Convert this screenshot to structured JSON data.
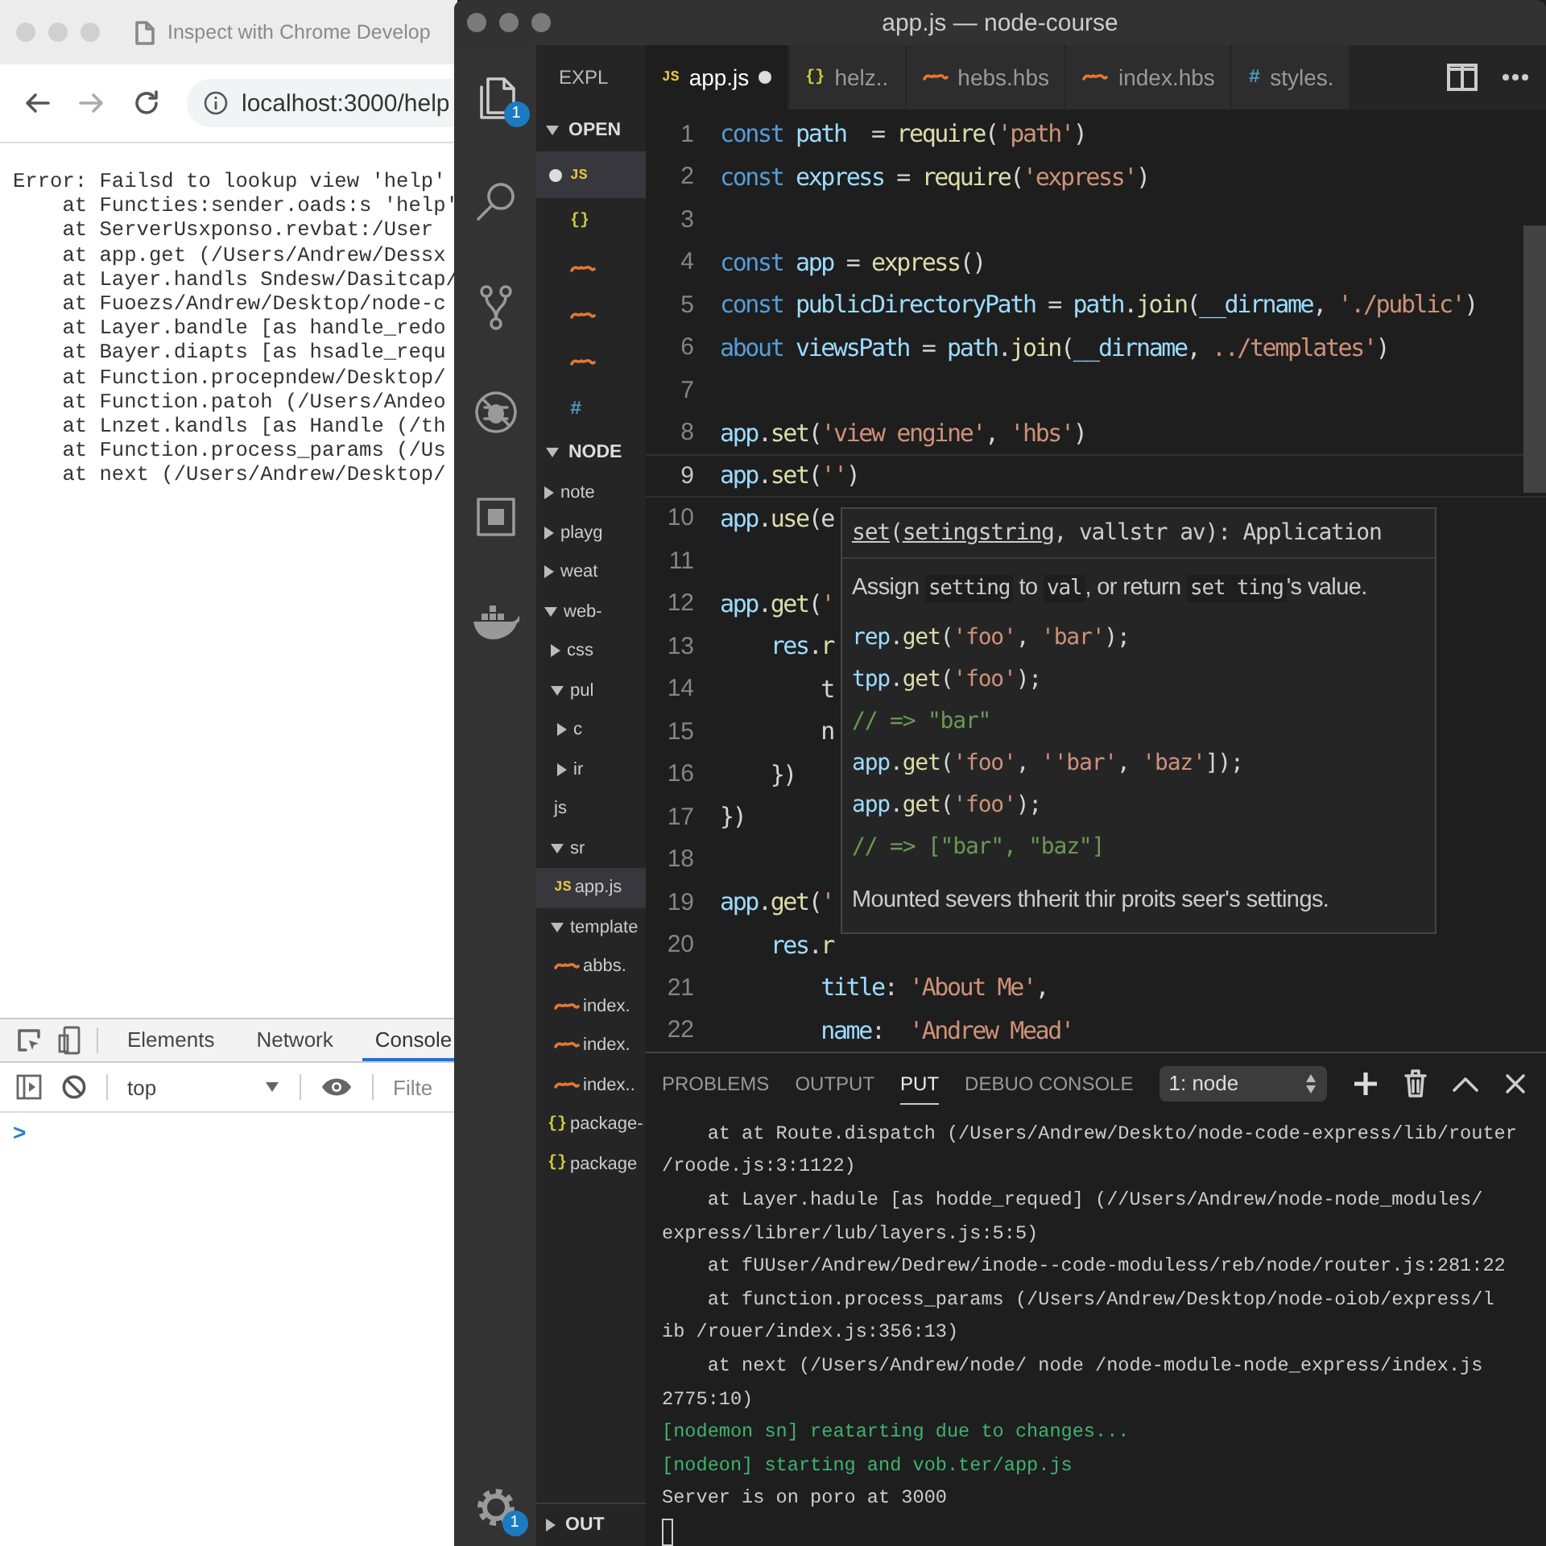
{
  "browser": {
    "tab_title": "Inspect with Chrome Develop",
    "url": "localhost:3000/help",
    "page_lines": [
      "Error: Failsd to lookup view 'help'",
      "    at Functies:sender.oads:s 'help'",
      "    at ServerUsxponso.revbat:/User",
      "    at app.get (/Users/Andrew/Dessx",
      "    at Layer.handls Sndesw/Dasitcap/",
      "    at Fuoezs/Andrew/Desktop/node-c",
      "    at Layer.bandle [as handle_redo",
      "    at Bayer.diapts [as hsadle_requ",
      "    at Function.procepndew/Desktop/",
      "    at Function.patoh (/Users/Andeo",
      "    at Lnzet.kandls [as Handle (/th",
      "    at Function.process_params (/Us",
      "    at next (/Users/Andrew/Desktop/"
    ],
    "devtools": {
      "tabs": [
        {
          "label": "Elements",
          "selected": false
        },
        {
          "label": "Network",
          "selected": false
        },
        {
          "label": "Console",
          "selected": true
        }
      ],
      "context": "top",
      "filter_placeholder": "Filte",
      "prompt": ">"
    }
  },
  "editor_window": {
    "title": "app.js — node-course",
    "activity_bar": {
      "items": [
        {
          "kind": "files",
          "badge": "1"
        },
        {
          "kind": "search"
        },
        {
          "kind": "branch"
        },
        {
          "kind": "debug"
        },
        {
          "kind": "extensions"
        },
        {
          "kind": "whale"
        }
      ],
      "manage": {
        "badge": "1"
      }
    },
    "sidebar": {
      "title": "EXPL",
      "open_editors": {
        "header": "OPEN",
        "expanded": true,
        "items": [
          {
            "kind": "js",
            "icon": "JS",
            "dirty": true,
            "selected": true
          },
          {
            "kind": "json",
            "icon": "{}",
            "dirty": false,
            "selected": false
          },
          {
            "kind": "hbs",
            "dirty": false,
            "selected": false
          },
          {
            "kind": "hbs",
            "dirty": false,
            "selected": false
          },
          {
            "kind": "hbs",
            "dirty": false,
            "selected": false
          },
          {
            "kind": "css",
            "icon": "#",
            "dirty": false,
            "selected": false
          }
        ]
      },
      "folder": {
        "header": "NODE",
        "expanded": true,
        "items": [
          {
            "kind": "folder",
            "label": "note",
            "expanded": false,
            "selected": false
          },
          {
            "kind": "folder",
            "label": "playg",
            "expanded": false,
            "selected": false
          },
          {
            "kind": "folder",
            "label": "weat",
            "expanded": false,
            "selected": false
          },
          {
            "kind": "folder",
            "label": "web-",
            "expanded": true,
            "selected": false,
            "children": [
              {
                "kind": "folder",
                "label": "css",
                "expanded": false,
                "selected": false
              },
              {
                "kind": "folder",
                "label": "pul",
                "expanded": true,
                "selected": false,
                "children": [
                  {
                    "kind": "folder",
                    "label": "c",
                    "expanded": false,
                    "selected": false
                  },
                  {
                    "kind": "folder",
                    "label": "ir",
                    "expanded": false,
                    "selected": false
                  },
                  {
                    "kind": "plain",
                    "label": "js",
                    "selected": false
                  }
                ]
              },
              {
                "kind": "folder",
                "label": "sr",
                "expanded": true,
                "selected": false,
                "children": [
                  {
                    "kind": "js",
                    "icon": "JS",
                    "label": "app.js",
                    "selected": true
                  }
                ]
              },
              {
                "kind": "folder",
                "label": "template",
                "expanded": true,
                "selected": false,
                "children": [
                  {
                    "kind": "hbs",
                    "label": "abbs.",
                    "selected": false
                  },
                  {
                    "kind": "hbs",
                    "label": "index.",
                    "selected": false
                  },
                  {
                    "kind": "hbs",
                    "label": "index.",
                    "selected": false
                  },
                  {
                    "kind": "hbs",
                    "label": "index..",
                    "selected": false
                  }
                ]
              },
              {
                "kind": "json",
                "icon": "{}",
                "label": "package-",
                "selected": false
              },
              {
                "kind": "json",
                "icon": "{}",
                "label": "package",
                "selected": false
              }
            ]
          }
        ]
      },
      "outline": {
        "header": "OUT",
        "expanded": false
      }
    },
    "tabs": [
      {
        "kind": "js",
        "icon": "JS",
        "label": "app.js",
        "selected": true,
        "dirty": true
      },
      {
        "kind": "json",
        "icon": "{}",
        "label": "helz..",
        "selected": false,
        "dirty": false
      },
      {
        "kind": "hbs",
        "label": "hebs.hbs",
        "selected": false,
        "dirty": false
      },
      {
        "kind": "hbs",
        "label": "index.hbs",
        "selected": false,
        "dirty": false
      },
      {
        "kind": "css",
        "icon": "#",
        "label": "styles.",
        "selected": false,
        "dirty": false
      }
    ],
    "code_lines": [
      {
        "number": "1",
        "current": false,
        "tokens": [
          {
            "kind": "keyword",
            "text": "const "
          },
          {
            "kind": "name",
            "text": "path"
          },
          {
            "kind": "plain",
            "text": "  = "
          },
          {
            "kind": "call",
            "text": "require"
          },
          {
            "kind": "plain",
            "text": "("
          },
          {
            "kind": "string",
            "text": "'path'"
          },
          {
            "kind": "plain",
            "text": ")"
          }
        ]
      },
      {
        "number": "2",
        "current": false,
        "tokens": [
          {
            "kind": "keyword",
            "text": "const "
          },
          {
            "kind": "name",
            "text": "express"
          },
          {
            "kind": "plain",
            "text": " = "
          },
          {
            "kind": "call",
            "text": "require"
          },
          {
            "kind": "plain",
            "text": "("
          },
          {
            "kind": "string",
            "text": "'express'"
          },
          {
            "kind": "plain",
            "text": ")"
          }
        ]
      },
      {
        "number": "3",
        "current": false
      },
      {
        "number": "4",
        "current": false,
        "tokens": [
          {
            "kind": "keyword",
            "text": "const "
          },
          {
            "kind": "name",
            "text": "app"
          },
          {
            "kind": "plain",
            "text": " = "
          },
          {
            "kind": "call",
            "text": "express"
          },
          {
            "kind": "plain",
            "text": "()"
          }
        ]
      },
      {
        "number": "5",
        "current": false,
        "tokens": [
          {
            "kind": "keyword",
            "text": "const "
          },
          {
            "kind": "name",
            "text": "publicDirectoryPath"
          },
          {
            "kind": "plain",
            "text": " = "
          },
          {
            "kind": "name",
            "text": "path"
          },
          {
            "kind": "plain",
            "text": "."
          },
          {
            "kind": "call",
            "text": "join"
          },
          {
            "kind": "plain",
            "text": "("
          },
          {
            "kind": "name",
            "text": "__dirname"
          },
          {
            "kind": "plain",
            "text": ", "
          },
          {
            "kind": "string",
            "text": "'./public'"
          },
          {
            "kind": "plain",
            "text": ")"
          }
        ]
      },
      {
        "number": "6",
        "current": false,
        "tokens": [
          {
            "kind": "keyword",
            "text": "about "
          },
          {
            "kind": "name",
            "text": "viewsPath"
          },
          {
            "kind": "plain",
            "text": " = "
          },
          {
            "kind": "name",
            "text": "path"
          },
          {
            "kind": "plain",
            "text": "."
          },
          {
            "kind": "call",
            "text": "join"
          },
          {
            "kind": "plain",
            "text": "("
          },
          {
            "kind": "name",
            "text": "__dirname"
          },
          {
            "kind": "plain",
            "text": ", "
          },
          {
            "kind": "string",
            "text": "../templates'"
          },
          {
            "kind": "plain",
            "text": ")"
          }
        ]
      },
      {
        "number": "7",
        "current": false
      },
      {
        "number": "8",
        "current": false,
        "tokens": [
          {
            "kind": "name",
            "text": "app"
          },
          {
            "kind": "plain",
            "text": "."
          },
          {
            "kind": "call",
            "text": "set"
          },
          {
            "kind": "plain",
            "text": "("
          },
          {
            "kind": "string",
            "text": "'view engine'"
          },
          {
            "kind": "plain",
            "text": ", "
          },
          {
            "kind": "string",
            "text": "'hbs'"
          },
          {
            "kind": "plain",
            "text": ")"
          }
        ]
      },
      {
        "number": "9",
        "current": true,
        "tokens": [
          {
            "kind": "name",
            "text": "app"
          },
          {
            "kind": "plain",
            "text": "."
          },
          {
            "kind": "call",
            "text": "set"
          },
          {
            "kind": "plain",
            "text": "("
          },
          {
            "kind": "string",
            "text": "''"
          },
          {
            "kind": "plain",
            "text": ")"
          }
        ]
      },
      {
        "number": "10",
        "current": false,
        "tokens": [
          {
            "kind": "name",
            "text": "app"
          },
          {
            "kind": "plain",
            "text": "."
          },
          {
            "kind": "call",
            "text": "use"
          },
          {
            "kind": "plain",
            "text": "(e"
          }
        ]
      },
      {
        "number": "11",
        "current": false
      },
      {
        "number": "12",
        "current": false,
        "tokens": [
          {
            "kind": "name",
            "text": "app"
          },
          {
            "kind": "plain",
            "text": "."
          },
          {
            "kind": "call",
            "text": "get"
          },
          {
            "kind": "plain",
            "text": "("
          },
          {
            "kind": "string",
            "text": "'"
          }
        ]
      },
      {
        "number": "13",
        "current": false,
        "tokens": [
          {
            "kind": "name",
            "text": "    res"
          },
          {
            "kind": "plain",
            "text": "."
          },
          {
            "kind": "call",
            "text": "r"
          }
        ]
      },
      {
        "number": "14",
        "current": false,
        "tokens": [
          {
            "kind": "plain",
            "text": "        t"
          }
        ]
      },
      {
        "number": "15",
        "current": false,
        "tokens": [
          {
            "kind": "plain",
            "text": "        n"
          }
        ]
      },
      {
        "number": "16",
        "current": false,
        "tokens": [
          {
            "kind": "plain",
            "text": "    })"
          }
        ]
      },
      {
        "number": "17",
        "current": false,
        "tokens": [
          {
            "kind": "plain",
            "text": "})"
          }
        ]
      },
      {
        "number": "18",
        "current": false
      },
      {
        "number": "19",
        "current": false,
        "tokens": [
          {
            "kind": "name",
            "text": "app"
          },
          {
            "kind": "plain",
            "text": "."
          },
          {
            "kind": "call",
            "text": "get"
          },
          {
            "kind": "plain",
            "text": "("
          },
          {
            "kind": "string",
            "text": "'"
          }
        ]
      },
      {
        "number": "20",
        "current": false,
        "tokens": [
          {
            "kind": "name",
            "text": "    res"
          },
          {
            "kind": "plain",
            "text": "."
          },
          {
            "kind": "call",
            "text": "r"
          }
        ]
      },
      {
        "number": "21",
        "current": false,
        "tokens": [
          {
            "kind": "name",
            "text": "        title"
          },
          {
            "kind": "plain",
            "text": ": "
          },
          {
            "kind": "string",
            "text": "'About Me'"
          },
          {
            "kind": "plain",
            "text": ","
          }
        ]
      },
      {
        "number": "22",
        "current": false,
        "tokens": [
          {
            "kind": "name",
            "text": "        name"
          },
          {
            "kind": "plain",
            "text": ":  "
          },
          {
            "kind": "string",
            "text": "'Andrew Mead'"
          }
        ]
      }
    ],
    "hover": {
      "signature": [
        {
          "text": "set",
          "underline": true
        },
        {
          "text": "(",
          "underline": false
        },
        {
          "text": "setingstring",
          "underline": true
        },
        {
          "text": ", vallstr av): Application",
          "underline": false
        }
      ],
      "description": [
        {
          "text": "Assign ",
          "code": false
        },
        {
          "text": "setting",
          "code": true
        },
        {
          "text": " to ",
          "code": false
        },
        {
          "text": "val",
          "code": true
        },
        {
          "text": ", or return ",
          "code": false
        },
        {
          "text": "set ting",
          "code": true
        },
        {
          "text": "'s value.",
          "code": false
        }
      ],
      "example": [
        [
          {
            "kind": "name",
            "text": "rep"
          },
          {
            "kind": "plain",
            "text": "."
          },
          {
            "kind": "call",
            "text": "get"
          },
          {
            "kind": "plain",
            "text": "("
          },
          {
            "kind": "string",
            "text": "'foo'"
          },
          {
            "kind": "plain",
            "text": ", "
          },
          {
            "kind": "string",
            "text": "'bar'"
          },
          {
            "kind": "plain",
            "text": ");"
          }
        ],
        [
          {
            "kind": "name",
            "text": "tpp"
          },
          {
            "kind": "plain",
            "text": "."
          },
          {
            "kind": "call",
            "text": "get"
          },
          {
            "kind": "plain",
            "text": "("
          },
          {
            "kind": "string",
            "text": "'foo'"
          },
          {
            "kind": "plain",
            "text": ");"
          }
        ],
        [
          {
            "kind": "comment",
            "text": "// => \"bar\""
          }
        ],
        [
          {
            "kind": "name",
            "text": "app"
          },
          {
            "kind": "plain",
            "text": "."
          },
          {
            "kind": "call",
            "text": "get"
          },
          {
            "kind": "plain",
            "text": "("
          },
          {
            "kind": "string",
            "text": "'foo'"
          },
          {
            "kind": "plain",
            "text": ", "
          },
          {
            "kind": "string",
            "text": "''bar'"
          },
          {
            "kind": "plain",
            "text": ", "
          },
          {
            "kind": "string",
            "text": "'baz'"
          },
          {
            "kind": "plain",
            "text": "]);"
          }
        ],
        [
          {
            "kind": "name",
            "text": "app"
          },
          {
            "kind": "plain",
            "text": "."
          },
          {
            "kind": "call",
            "text": "get"
          },
          {
            "kind": "plain",
            "text": "("
          },
          {
            "kind": "string",
            "text": "'foo'"
          },
          {
            "kind": "plain",
            "text": ");"
          }
        ],
        [
          {
            "kind": "comment",
            "text": "// => [\"bar\", \"baz\"]"
          }
        ]
      ],
      "note": "Mounted severs thherit thir proits seer's settings."
    },
    "panel": {
      "tabs": [
        {
          "label": "PROBLEMS",
          "selected": false
        },
        {
          "label": "OUTPUT",
          "selected": false
        },
        {
          "label": "PUT",
          "selected": true
        },
        {
          "label": "DEBUO CONSOLE",
          "selected": false
        }
      ],
      "terminal": "1: node",
      "cursor": true,
      "lines": [
        {
          "kind": "out",
          "text": "    at at Route.dispatch (/Users/Andrew/Deskto/node-code-express/lib/router"
        },
        {
          "kind": "out",
          "text": "/roode.js:3:1122)"
        },
        {
          "kind": "out",
          "text": "    at Layer.hadule [as hodde_requed] (//Users/Andrew/node-node_modules/"
        },
        {
          "kind": "out",
          "text": "express/librer/lub/layers.js:5:5)"
        },
        {
          "kind": "out",
          "text": "    at fUUser/Andrew/Dedrew/inode--code-moduless/reb/node/router.js:281:22"
        },
        {
          "kind": "out",
          "text": "    at function.process_params (/Users/Andrew/Desktop/node-oiob/express/l"
        },
        {
          "kind": "out",
          "text": "ib /rouer/index.js:356:13)"
        },
        {
          "kind": "out",
          "text": "    at next (/Users/Andrew/node/ node /node-module-node_express/index.js"
        },
        {
          "kind": "out",
          "text": "2775:10)"
        },
        {
          "kind": "info",
          "text": "[nodemon sn] reatarting due to changes..."
        },
        {
          "kind": "info",
          "text": "[nodeon] starting and vob.ter/app.js"
        },
        {
          "kind": "out",
          "text": "Server is on poro at 3000"
        }
      ]
    }
  }
}
